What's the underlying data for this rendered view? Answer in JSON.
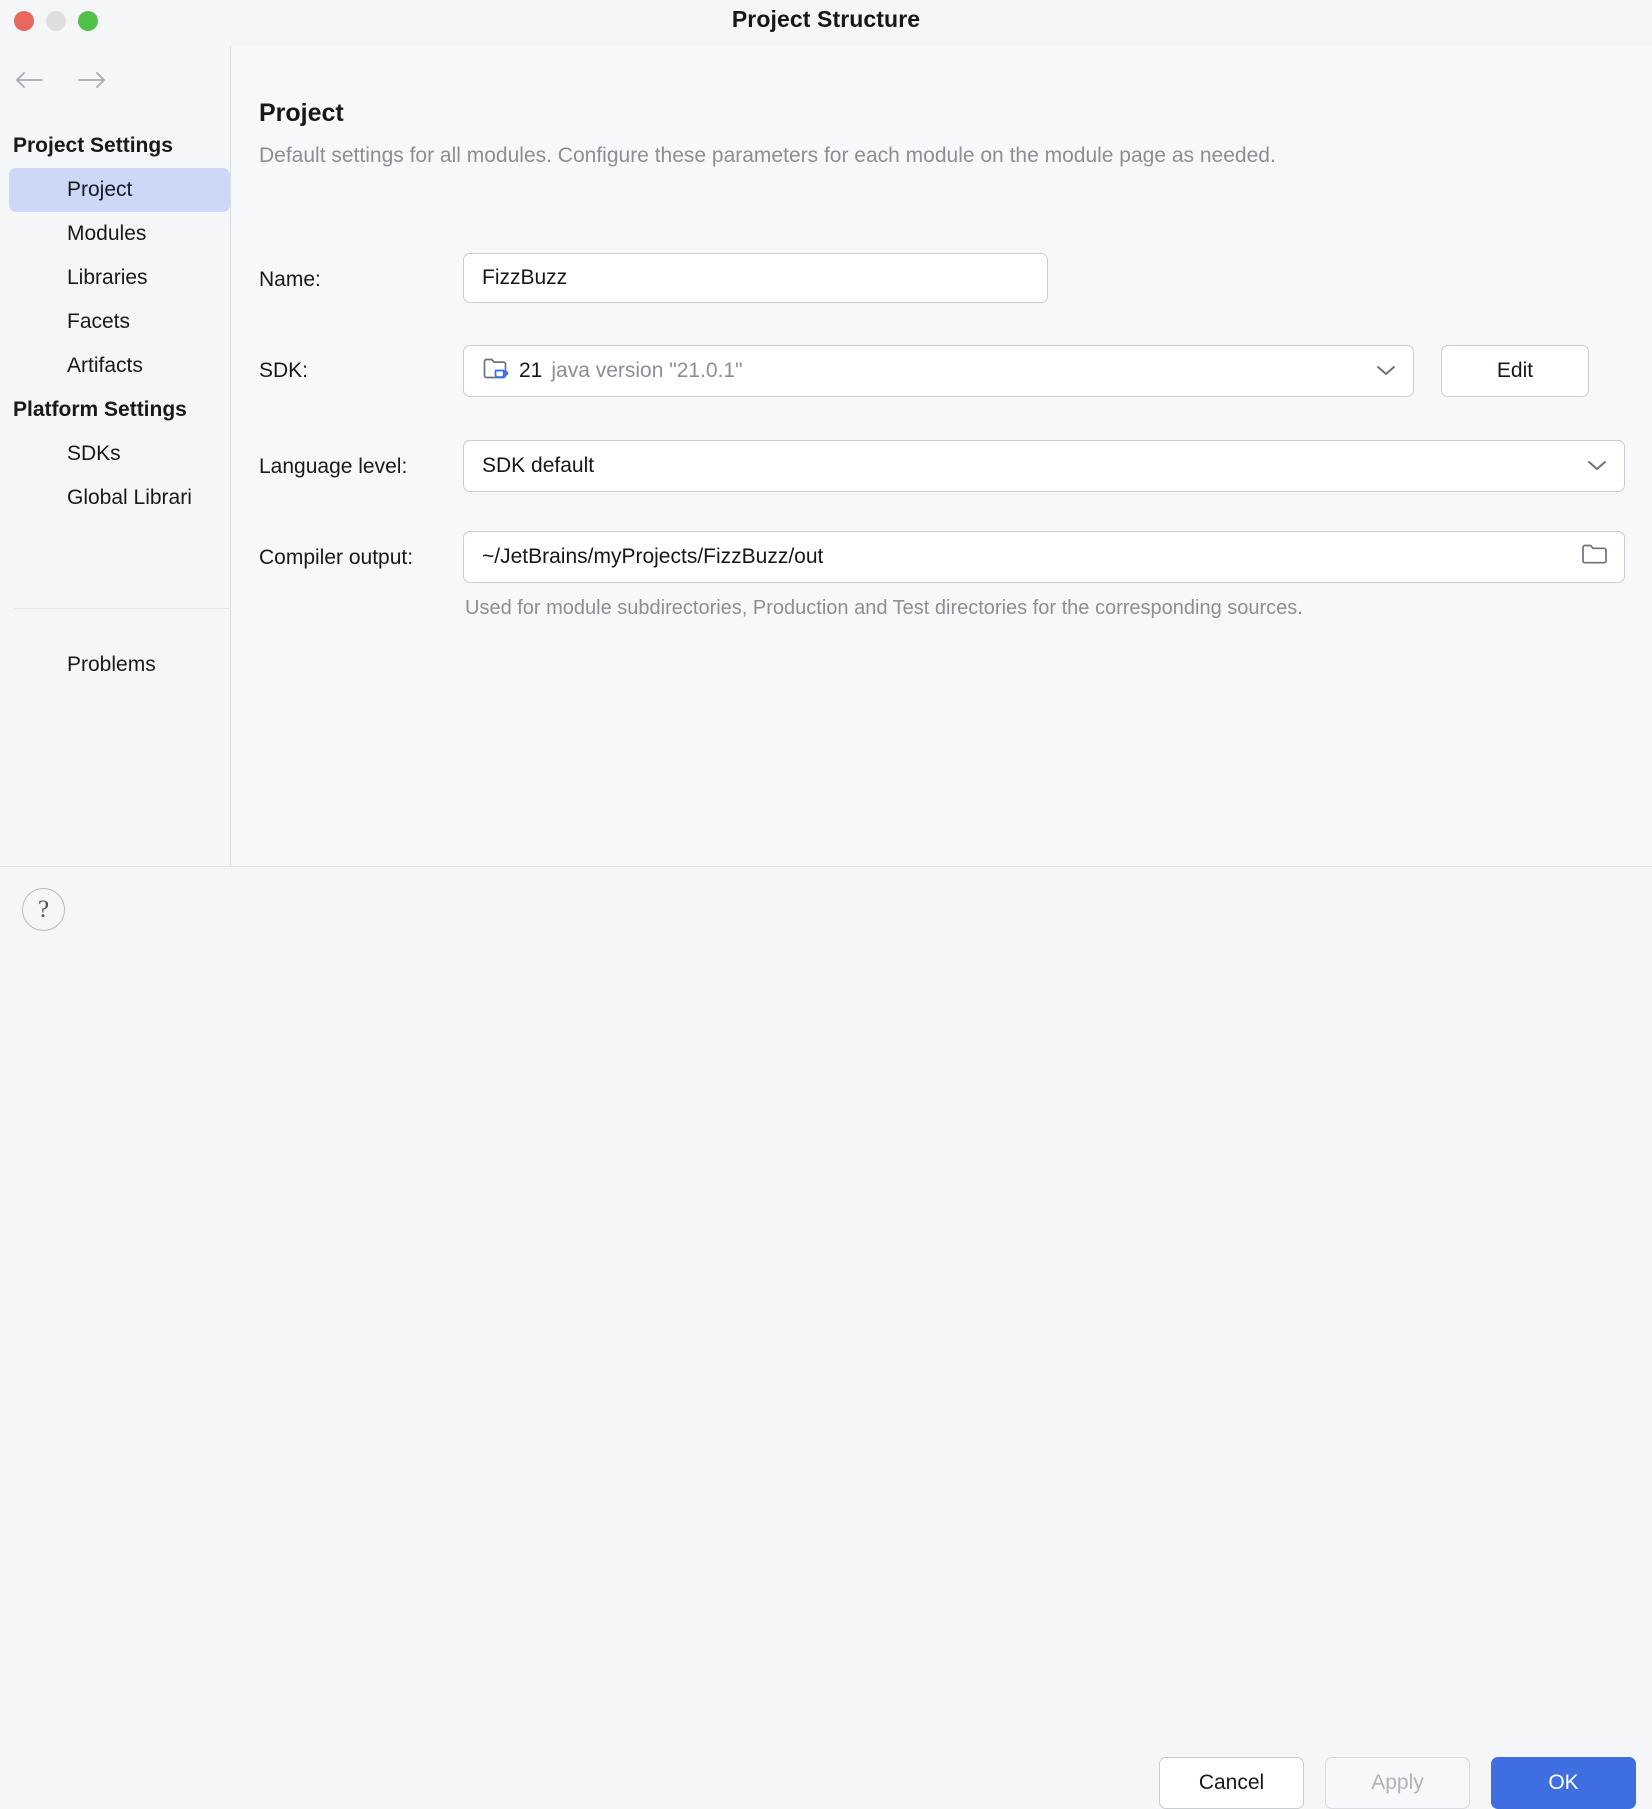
{
  "window": {
    "title": "Project Structure",
    "traffic_lights": [
      "close-red",
      "minimize-yellow",
      "zoom-green"
    ],
    "colors": {
      "close": "#e8685f",
      "minimize": "#dedede",
      "zoom": "#52c14a",
      "accent": "#3e6ee0",
      "selection": "#ccd8f5",
      "muted_text": "#8b8e96"
    }
  },
  "sidebar": {
    "back_label": "Back",
    "forward_label": "Forward",
    "groups": [
      {
        "label": "Project Settings",
        "items": [
          {
            "label": "Project",
            "selected": true
          },
          {
            "label": "Modules",
            "selected": false
          },
          {
            "label": "Libraries",
            "selected": false
          },
          {
            "label": "Facets",
            "selected": false
          },
          {
            "label": "Artifacts",
            "selected": false
          }
        ]
      },
      {
        "label": "Platform Settings",
        "items": [
          {
            "label": "SDKs",
            "selected": false
          },
          {
            "label": "Global Librari",
            "selected": false
          }
        ]
      }
    ],
    "problems": {
      "label": "Problems"
    }
  },
  "main": {
    "title": "Project",
    "subtitle": "Default settings for all modules. Configure these parameters for each module on the module page as needed.",
    "fields": {
      "name": {
        "label": "Name:",
        "value": "FizzBuzz"
      },
      "sdk": {
        "label": "SDK:",
        "icon": "java-sdk-folder-icon",
        "value": "21",
        "version": "java version \"21.0.1\"",
        "edit_label": "Edit"
      },
      "language_level": {
        "label": "Language level:",
        "value": "SDK default"
      },
      "compiler_output": {
        "label": "Compiler output:",
        "value": "~/JetBrains/myProjects/FizzBuzz/out",
        "browse_icon": "folder-icon",
        "hint": "Used for module subdirectories, Production and Test directories for the corresponding sources."
      }
    }
  },
  "footer": {
    "help_label": "?",
    "cancel_label": "Cancel",
    "apply_label": "Apply",
    "apply_enabled": false,
    "ok_label": "OK"
  }
}
